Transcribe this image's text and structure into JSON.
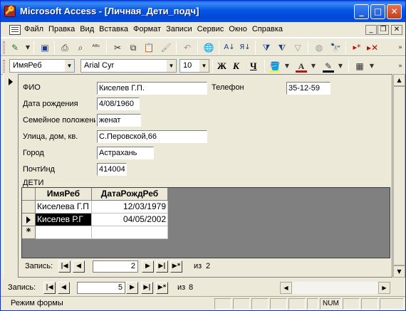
{
  "window": {
    "title": "Microsoft Access - [Личная_Дети_подч]",
    "minimize": "_",
    "maximize": "□",
    "close": "✕"
  },
  "menu": {
    "items": [
      "Файл",
      "Правка",
      "Вид",
      "Вставка",
      "Формат",
      "Записи",
      "Сервис",
      "Окно",
      "Справка"
    ],
    "mdi_minimize": "_",
    "mdi_restore": "❐",
    "mdi_close": "✕"
  },
  "format_toolbar": {
    "object_combo": "ИмяРеб",
    "font_combo": "Arial Cyr",
    "size_combo": "10",
    "bold": "Ж",
    "italic": "К",
    "underline": "Ч"
  },
  "form": {
    "fields": {
      "fio_label": "ФИО",
      "fio_value": "Киселев Г.П.",
      "phone_label": "Телефон",
      "phone_value": "35-12-59",
      "birth_label": "Дата рождения",
      "birth_value": "4/08/1960",
      "marital_label": "Семейное положени",
      "marital_value": "женат",
      "address_label": "Улица, дом, кв.",
      "address_value": "С.Перовской,66",
      "city_label": "Город",
      "city_value": "Астрахань",
      "zip_label": "ПочтИнд",
      "zip_value": "414004"
    },
    "subform_label": "ДЕТИ"
  },
  "subform": {
    "columns": [
      "ИмяРеб",
      "ДатаРождРеб"
    ],
    "rows": [
      {
        "name": "Киселева Г.П",
        "date": "12/03/1979"
      },
      {
        "name": "Киселев Р.Г",
        "date": "04/05/2002"
      }
    ],
    "new_row_marker": "*",
    "nav": {
      "label": "Запись:",
      "current": "2",
      "of": "из",
      "total": "2"
    }
  },
  "main_nav": {
    "label": "Запись:",
    "current": "5",
    "of": "из",
    "total": "8"
  },
  "status": {
    "text": "Режим формы",
    "num": "NUM"
  }
}
